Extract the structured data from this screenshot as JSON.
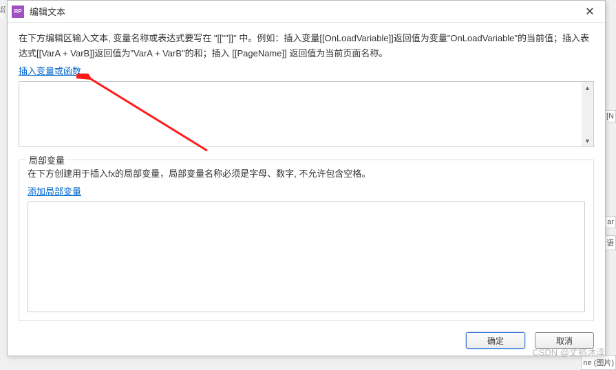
{
  "titlebar": {
    "app_icon_label": "RP",
    "title": "编辑文本"
  },
  "description": "在下方编辑区输入文本, 变量名称或表达式要写在 \"[[\"\"]]\" 中。例如：插入变量[[OnLoadVariable]]返回值为变量\"OnLoadVariable\"的当前值；插入表达式[[VarA + VarB]]返回值为\"VarA + VarB\"的和；插入 [[PageName]] 返回值为当前页面名称。",
  "insert_link": "插入变量或函数...",
  "local_vars": {
    "legend": "局部变量",
    "desc": "在下方创建用于插入fx的局部变量，局部变量名称必须是字母、数字, 不允许包含空格。",
    "add_link": "添加局部变量"
  },
  "buttons": {
    "ok": "确定",
    "cancel": "取消"
  },
  "watermark": "CSDN @丈掐沐泽",
  "side_fragments": {
    "left": "段",
    "r1": "[N",
    "r2": "ar",
    "r3": "语",
    "r4": "ne (图片)"
  }
}
